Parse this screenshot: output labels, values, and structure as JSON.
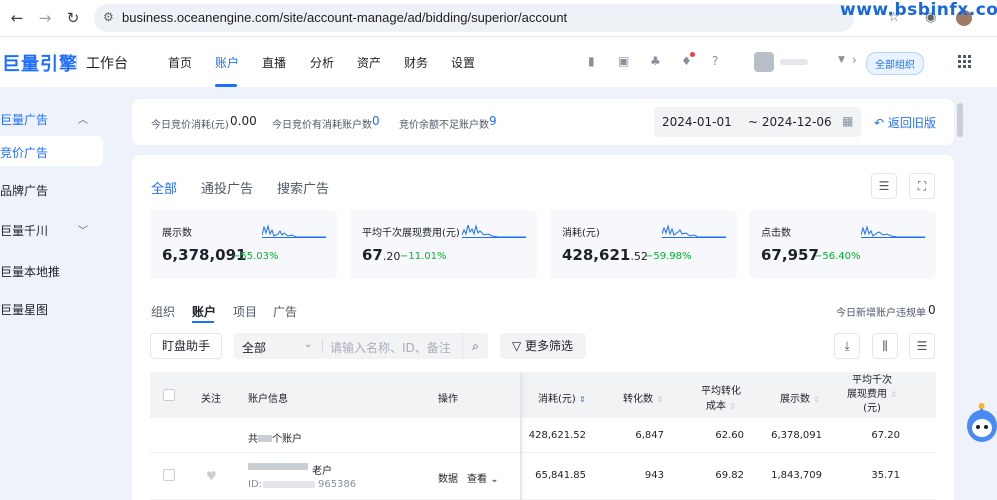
{
  "browser": {
    "url": "business.oceanengine.com/site/account-manage/ad/bidding/superior/account",
    "watermark": "www.bsbinfx.com"
  },
  "header": {
    "logo": "巨量引擎",
    "workbench": "工作台",
    "nav": [
      "首页",
      "账户",
      "直播",
      "分析",
      "资产",
      "财务",
      "设置"
    ],
    "active_nav": "账户",
    "org_badge": "全部组织"
  },
  "sidebar": {
    "items": [
      {
        "label": "巨量广告",
        "type": "group",
        "expanded": true
      },
      {
        "label": "竞价广告",
        "type": "item",
        "active": true
      },
      {
        "label": "品牌广告",
        "type": "item"
      },
      {
        "label": "巨量千川",
        "type": "group",
        "expanded": false
      },
      {
        "label": "巨量本地推",
        "type": "item"
      },
      {
        "label": "巨量星图",
        "type": "item"
      }
    ]
  },
  "summary": {
    "today_spend_label": "今日竞价消耗(元)",
    "today_spend_value": "0.00",
    "active_accounts_label": "今日竞价有消耗账户数",
    "active_accounts_value": "0",
    "low_balance_label": "竞价余额不足账户数",
    "low_balance_value": "9",
    "date_start": "2024-01-01",
    "date_end": "~ 2024-12-06",
    "back_label": "返回旧版"
  },
  "main": {
    "tabs": [
      "全部",
      "通投广告",
      "搜索广告"
    ],
    "active_tab": "全部",
    "metrics": [
      {
        "label": "展示数",
        "value": "6,378,091",
        "decimal": "",
        "change": "−55.03%"
      },
      {
        "label": "平均千次展现费用(元)",
        "value": "67",
        "decimal": ".20",
        "change": "−11.01%"
      },
      {
        "label": "消耗(元)",
        "value": "428,621",
        "decimal": ".52",
        "change": "−59.98%"
      },
      {
        "label": "点击数",
        "value": "67,957",
        "decimal": "",
        "change": "−56.40%"
      }
    ],
    "subtabs": [
      "组织",
      "账户",
      "项目",
      "广告"
    ],
    "active_subtab": "账户",
    "new_violation_label": "今日新增账户违规单",
    "new_violation_value": "0",
    "toolbar": {
      "helper_label": "盯盘助手",
      "filter_select": "全部",
      "search_placeholder": "请输入名称、ID、备注",
      "more_filter_label": "更多筛选"
    },
    "table": {
      "headers": {
        "follow": "关注",
        "account_info": "账户信息",
        "ops": "操作",
        "spend": "消耗(元)",
        "conversions": "转化数",
        "avg_conv_cost_1": "平均转化",
        "avg_conv_cost_2": "成本",
        "impressions": "展示数",
        "cpm_1": "平均千次",
        "cpm_2": "展现费用",
        "cpm_3": "(元)"
      },
      "total_row": {
        "label_prefix": "共",
        "label_suffix": "个账户",
        "spend": "428,621.52",
        "conversions": "6,847",
        "avg_conv_cost": "62.60",
        "impressions": "6,378,091",
        "cpm": "67.20"
      },
      "rows": [
        {
          "name_suffix": "老户",
          "id_prefix": "ID:",
          "id_suffix": "965386",
          "op_data": "数据",
          "op_view": "查看",
          "spend": "65,841.85",
          "conversions": "943",
          "avg_conv_cost": "69.82",
          "impressions": "1,843,709",
          "cpm": "35.71"
        }
      ]
    }
  },
  "colors": {
    "brand": "#1f6fff",
    "positive_change": "#00b42a",
    "page_bg": "#eef3fb"
  }
}
